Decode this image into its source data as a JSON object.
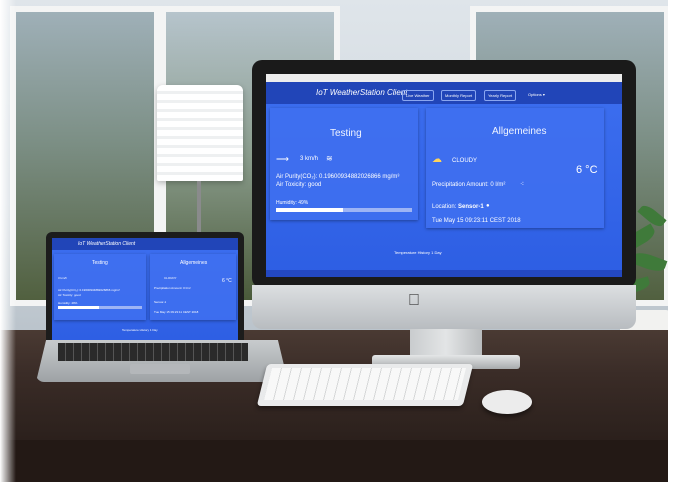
{
  "app": {
    "title": "IoT WeatherStation Client",
    "nav": {
      "live_weather": "Live Weather",
      "monthly_report": "Monthly Report",
      "yearly_report": "Yearly Report",
      "options": "Options ▾"
    }
  },
  "testing_card": {
    "title": "Testing",
    "wind": "3 km/h",
    "air_purity": "Air Purity(CO₂): 0.19600934882026866 mg/m³",
    "air_toxicity": "Air Toxicity: good",
    "humidity_label": "Humidity: 49%",
    "humidity_level": 0.49
  },
  "general_card": {
    "title": "Allgemeines",
    "condition": "CLOUDY",
    "temperature": "6 °C",
    "precipitation": "Precipitation Amount: 0 l/m²",
    "location_label": "Location:",
    "location_value": "Sensor-1",
    "timestamp": "Tue May 15 09:23:11 CEST 2018"
  },
  "history_label": "Temperature History 1 Day",
  "colors": {
    "screen_bg": "#3d6ff0",
    "navbar": "#2145b8",
    "text": "#ffffff"
  }
}
